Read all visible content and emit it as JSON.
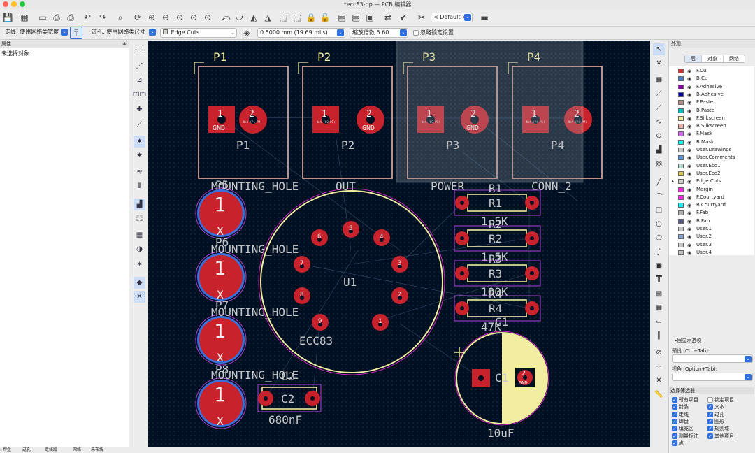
{
  "window": {
    "title": "*ecc83-pp — PCB 编辑器"
  },
  "toolbar2": {
    "track_label": "走线: 使用网络类宽度",
    "via_label": "过孔: 使用网络类尺寸",
    "layer_value": "Edge.Cuts",
    "grid_value": "0.5000 mm (19.69 mils)",
    "zoom_value": "缩放倍数 5.60",
    "ignore_lock_label": "忽略锁定设置",
    "viewport_value": "< Default >"
  },
  "left_panel": {
    "title": "属性",
    "empty_text": "未选择对象"
  },
  "right_panel": {
    "title": "外观",
    "tabs": [
      "层",
      "对象",
      "网络"
    ],
    "layers": [
      {
        "name": "F.Cu",
        "color": "#c83434"
      },
      {
        "name": "B.Cu",
        "color": "#4d7fc4"
      },
      {
        "name": "F.Adhesive",
        "color": "#84009f"
      },
      {
        "name": "B.Adhesive",
        "color": "#0000a0"
      },
      {
        "name": "F.Paste",
        "color": "#b48c8c"
      },
      {
        "name": "B.Paste",
        "color": "#00c2c2"
      },
      {
        "name": "F.Silkscreen",
        "color": "#f2eda1"
      },
      {
        "name": "B.Silkscreen",
        "color": "#e8b2a7"
      },
      {
        "name": "F.Mask",
        "color": "#d864ff"
      },
      {
        "name": "B.Mask",
        "color": "#02ffee"
      },
      {
        "name": "User.Drawings",
        "color": "#c2c2c2"
      },
      {
        "name": "User.Comments",
        "color": "#5994dc"
      },
      {
        "name": "User.Eco1",
        "color": "#b4dbd2"
      },
      {
        "name": "User.Eco2",
        "color": "#d8c852"
      },
      {
        "name": "Edge.Cuts",
        "color": "#d0d2cd"
      },
      {
        "name": "Margin",
        "color": "#ff26e2"
      },
      {
        "name": "F.Courtyard",
        "color": "#ff26e2"
      },
      {
        "name": "B.Courtyard",
        "color": "#26e9ff"
      },
      {
        "name": "F.Fab",
        "color": "#afafaf"
      },
      {
        "name": "B.Fab",
        "color": "#585d84"
      },
      {
        "name": "User.1",
        "color": "#c2c2c2"
      },
      {
        "name": "User.2",
        "color": "#89a5d6"
      },
      {
        "name": "User.3",
        "color": "#c2c2c2"
      },
      {
        "name": "User.4",
        "color": "#c2c2c2"
      }
    ],
    "active_layer": "Edge.Cuts",
    "layer_options_label": "层显示选项",
    "preset_label": "预设 (Ctrl+Tab):",
    "viewport_label": "视角 (Option+Tab):",
    "filter_title": "选择筛选器",
    "filters": [
      {
        "label": "所有项目",
        "checked": true
      },
      {
        "label": "锁定项目",
        "checked": false
      },
      {
        "label": "封装",
        "checked": true
      },
      {
        "label": "文本",
        "checked": true
      },
      {
        "label": "走线",
        "checked": true
      },
      {
        "label": "过孔",
        "checked": true
      },
      {
        "label": "焊盘",
        "checked": true
      },
      {
        "label": "图形",
        "checked": true
      },
      {
        "label": "填充区",
        "checked": true
      },
      {
        "label": "规则域",
        "checked": true
      },
      {
        "label": "测量标注",
        "checked": true
      },
      {
        "label": "其他项目",
        "checked": true
      },
      {
        "label": "点",
        "checked": true
      }
    ]
  },
  "board": {
    "connectors": [
      {
        "ref": "P1",
        "pad1_net": "GND",
        "pad2_net": "Net-(P1-PM)"
      },
      {
        "ref": "P2",
        "pad1_net": "Net-(P2-P1)",
        "pad2_net": "GND"
      },
      {
        "ref": "P3",
        "pad1_net": "Net-(P3-P1)",
        "pad2_net": "GND"
      },
      {
        "ref": "P4",
        "pad1_net": "Net-(P4-P1)",
        "pad2_net": "Net-(P4-PM)"
      }
    ],
    "connector_values": [
      "MOUNTING_HOLE",
      "OUT",
      "POWER",
      "CONN_2"
    ],
    "mounting_hole_refs": [
      "P5",
      "P6",
      "P7",
      "P8"
    ],
    "mounting_hole_value": "MOUNTING_HOLE",
    "tube": {
      "ref": "U1",
      "value": "ECC83",
      "pins": [
        "1",
        "2",
        "3",
        "4",
        "5",
        "6",
        "7",
        "8",
        "9"
      ]
    },
    "resistors": [
      {
        "ref": "R1",
        "value": "1.5K"
      },
      {
        "ref": "R2",
        "value": "1.5K"
      },
      {
        "ref": "R3",
        "value": "100K"
      },
      {
        "ref": "R4",
        "value": "47K"
      }
    ],
    "cap_c2": {
      "ref": "C2",
      "value": "680nF"
    },
    "cap_c1": {
      "ref": "C1",
      "value": "10uF",
      "pad2_net": "GND"
    },
    "pad_labels": {
      "one": "1",
      "two": "2",
      "x": "X"
    }
  },
  "status": {
    "items": [
      "焊盘",
      "过孔",
      "走线段",
      "网络",
      "未布线"
    ]
  }
}
